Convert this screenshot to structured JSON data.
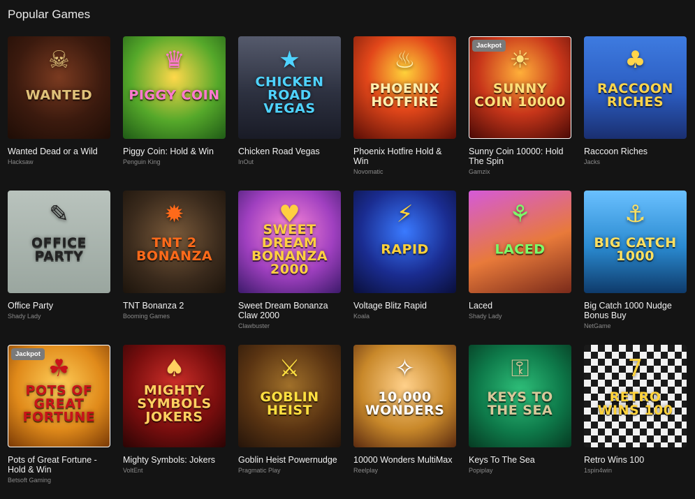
{
  "section": {
    "title": "Popular Games"
  },
  "games": [
    {
      "title": "Wanted Dead or a Wild",
      "provider": "Hacksaw",
      "art": "WANTED",
      "icon": "cowboy-icon",
      "glyph": "☠",
      "bg": "radial-gradient(circle at 50% 40%, #7a3a20 0%, #3b1a0e 55%, #1e0d06 100%)",
      "fg": "#e0c27a"
    },
    {
      "title": "Piggy Coin: Hold & Win",
      "provider": "Penguin King",
      "art": "PIGGY COIN",
      "icon": "pig-icon",
      "glyph": "♛",
      "bg": "radial-gradient(circle at 50% 40%, #ffd84a 0%, #55a82a 55%, #1f5a16 100%)",
      "fg": "#ff7ad0"
    },
    {
      "title": "Chicken Road Vegas",
      "provider": "InOut",
      "art": "CHICKEN ROAD Vegas",
      "icon": "chicken-icon",
      "glyph": "★",
      "bg": "linear-gradient(180deg, #555a6c 0%, #2d3140 55%, #191b26 100%)",
      "fg": "#4fd3ff"
    },
    {
      "title": "Phoenix Hotfire Hold & Win",
      "provider": "Novomatic",
      "art": "PHOENIX HOTFIRE",
      "icon": "phoenix-icon",
      "glyph": "♨",
      "bg": "radial-gradient(circle at 50% 35%, #ffd23a 0%, #e2471a 45%, #5a0e06 100%)",
      "fg": "#fff0b0"
    },
    {
      "title": "Sunny Coin 10000: Hold The Spin",
      "provider": "Gamzix",
      "art": "SUNNY COIN 10000",
      "icon": "queen-icon",
      "glyph": "☀",
      "bg": "radial-gradient(circle at 50% 35%, #ffb03a 0%, #c8361a 50%, #4a0a06 100%)",
      "fg": "#ffe07a",
      "badge": "Jackpot",
      "highlight": true
    },
    {
      "title": "Raccoon Riches",
      "provider": "Jacks",
      "art": "RACCOON RICHES",
      "icon": "raccoon-icon",
      "glyph": "♣",
      "bg": "linear-gradient(180deg, #3e7be0 0%, #2b5cc0 55%, #1a2f70 100%)",
      "fg": "#ffd54a"
    },
    {
      "title": "Office Party",
      "provider": "Shady Lady",
      "art": "OFFICE PARTY",
      "icon": "sticky-note-icon",
      "glyph": "✎",
      "bg": "linear-gradient(180deg, #b9c3bd 0%, #9aa69f 100%)",
      "fg": "#222222"
    },
    {
      "title": "TNT Bonanza 2",
      "provider": "Booming Games",
      "art": "TNT 2 BONANZA",
      "icon": "dynamite-icon",
      "glyph": "✹",
      "bg": "radial-gradient(circle at 50% 45%, #7a5a3a 0%, #3a2a1c 60%, #1c140c 100%)",
      "fg": "#ff6a1a"
    },
    {
      "title": "Sweet Dream Bonanza Claw 2000",
      "provider": "Clawbuster",
      "art": "SWEET DREAM BONANZA 2000",
      "icon": "dream-girl-icon",
      "glyph": "♥",
      "bg": "radial-gradient(circle at 50% 40%, #ff8ad8 0%, #a040c0 55%, #3c1a6a 100%)",
      "fg": "#ffd040"
    },
    {
      "title": "Voltage Blitz Rapid",
      "provider": "Koala",
      "art": "RAPID",
      "icon": "lightning-icon",
      "glyph": "⚡",
      "bg": "radial-gradient(circle at 50% 40%, #3a7aff 0%, #1a2c90 55%, #0a0f3a 100%)",
      "fg": "#ffd23a"
    },
    {
      "title": "Laced",
      "provider": "Shady Lady",
      "art": "LACED",
      "icon": "sneaker-icon",
      "glyph": "⚘",
      "bg": "linear-gradient(160deg, #d45ad8 0%, #e87a3a 55%, #7a2a1a 100%)",
      "fg": "#7aff6a"
    },
    {
      "title": "Big Catch 1000 Nudge Bonus Buy",
      "provider": "NetGame",
      "art": "BIG CATCH 1000",
      "icon": "fisherman-icon",
      "glyph": "⚓",
      "bg": "linear-gradient(180deg, #6ac0ff 0%, #2a8ad0 55%, #0e3a6a 100%)",
      "fg": "#ffe060"
    },
    {
      "title": "Pots of Great Fortune - Hold & Win",
      "provider": "Betsoft Gaming",
      "art": "POTS OF GREAT FORTUNE",
      "icon": "pot-icon",
      "glyph": "☘",
      "bg": "radial-gradient(circle at 50% 40%, #ffcf5a 0%, #e08a1a 55%, #7a3a06 100%)",
      "fg": "#c8141a",
      "badge": "Jackpot",
      "highlight": true
    },
    {
      "title": "Mighty Symbols: Jokers",
      "provider": "VoltEnt",
      "art": "MIGHTY SYMBOLS JOKERS",
      "icon": "joker-icon",
      "glyph": "♠",
      "bg": "radial-gradient(circle at 50% 40%, #d0302a 0%, #7a0e0e 55%, #2a0404 100%)",
      "fg": "#ffd060"
    },
    {
      "title": "Goblin Heist Powernudge",
      "provider": "Pragmatic Play",
      "art": "GOBLIN HEIST",
      "icon": "goblin-icon",
      "glyph": "⚔",
      "bg": "radial-gradient(circle at 50% 40%, #a0702a 0%, #5a3412 55%, #24140a 100%)",
      "fg": "#ffe040"
    },
    {
      "title": "10000 Wonders MultiMax",
      "provider": "Reelplay",
      "art": "10,000 Wonders",
      "icon": "genie-icon",
      "glyph": "✧",
      "bg": "radial-gradient(circle at 50% 40%, #ffd08a 0%, #c8882a 55%, #5a2a10 100%)",
      "fg": "#ffffff"
    },
    {
      "title": "Keys To The Sea",
      "provider": "Popiplay",
      "art": "KEYS TO THE SEA",
      "icon": "key-icon",
      "glyph": "⚿",
      "bg": "radial-gradient(circle at 50% 45%, #2fc07a 0%, #0e7a4a 55%, #063a22 100%)",
      "fg": "#d8c89a"
    },
    {
      "title": "Retro Wins 100",
      "provider": "1spin4win",
      "art": "RETRO WINS 100",
      "icon": "slot-seven-icon",
      "glyph": "7",
      "bg": "repeating-conic-gradient(#f2f2f2 0 25%, #1a1a1a 0 50%) 0 0/20px 20px",
      "fg": "#ffd23a"
    }
  ]
}
